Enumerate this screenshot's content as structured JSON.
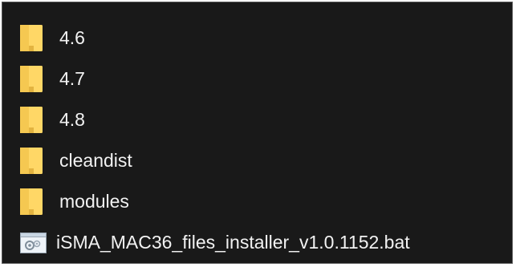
{
  "items": [
    {
      "label": "4.6",
      "type": "folder",
      "icon": "folder-icon"
    },
    {
      "label": "4.7",
      "type": "folder",
      "icon": "folder-icon"
    },
    {
      "label": "4.8",
      "type": "folder",
      "icon": "folder-icon"
    },
    {
      "label": "cleandist",
      "type": "folder",
      "icon": "folder-icon"
    },
    {
      "label": "modules",
      "type": "folder",
      "icon": "folder-icon"
    },
    {
      "label": "iSMA_MAC36_files_installer_v1.0.1152.bat",
      "type": "file",
      "icon": "batch-file-icon"
    }
  ],
  "colors": {
    "background": "#191919",
    "text": "#f2f2f2",
    "folder_fill": "#ffd766",
    "folder_shade": "#e3b340"
  }
}
